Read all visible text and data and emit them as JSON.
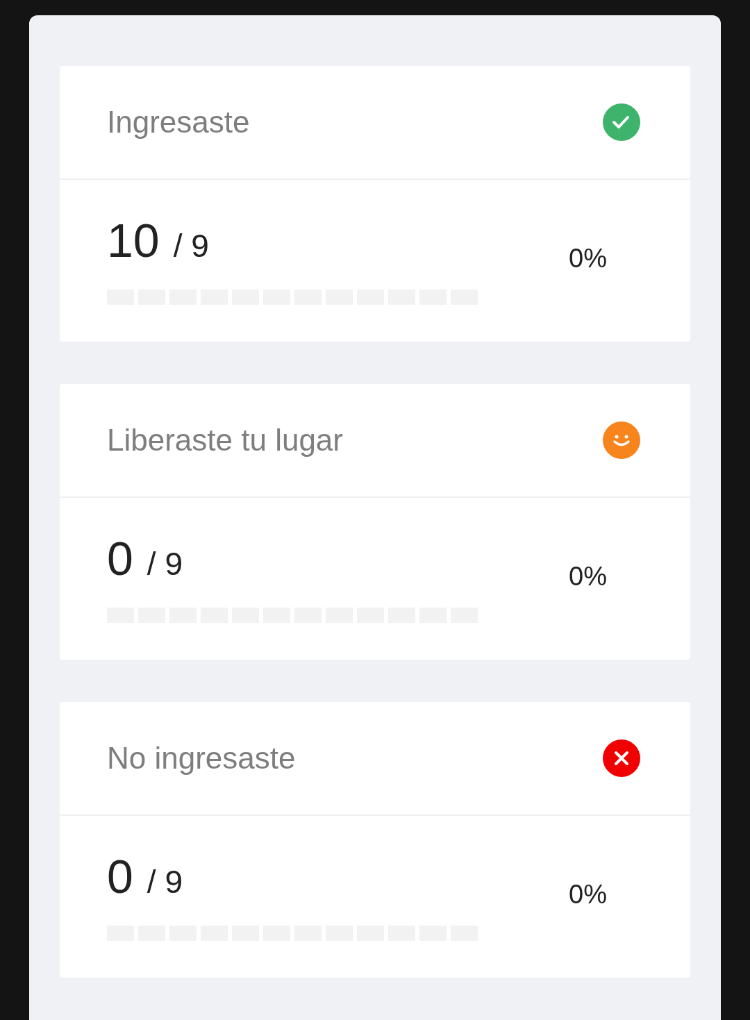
{
  "cards": [
    {
      "title": "Ingresaste",
      "status": {
        "kind": "check",
        "color": "#3db36b"
      },
      "count": "10",
      "total": "/ 9",
      "percent": "0%",
      "progress": {
        "level": 0
      }
    },
    {
      "title": "Liberaste tu lugar",
      "status": {
        "kind": "smile",
        "color": "#f7841c"
      },
      "count": "0",
      "total": "/ 9",
      "percent": "0%",
      "progress": {
        "level": 0
      }
    },
    {
      "title": "No ingresaste",
      "status": {
        "kind": "cross",
        "color": "#f00000"
      },
      "count": "0",
      "total": "/ 9",
      "percent": "0%",
      "progress": {
        "level": 0
      }
    }
  ]
}
